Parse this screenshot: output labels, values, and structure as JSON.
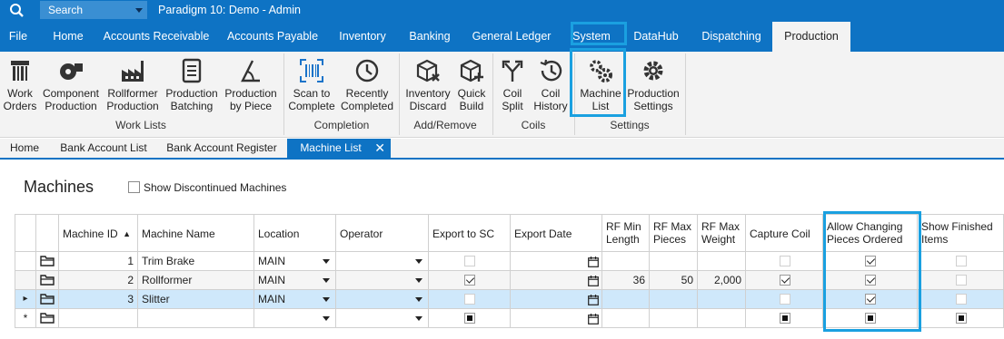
{
  "titlebar": {
    "search_placeholder": "Search",
    "app_title": "Paradigm 10: Demo - Admin"
  },
  "menu": {
    "items": [
      "File",
      "Home",
      "Accounts Receivable",
      "Accounts Payable",
      "Inventory",
      "Banking",
      "General Ledger",
      "System",
      "DataHub",
      "Dispatching",
      "Production"
    ],
    "active": "Production"
  },
  "ribbon": {
    "buttons": [
      {
        "line1": "Work",
        "line2": "Orders",
        "icon": "barcode-ruler-icon"
      },
      {
        "line1": "Component",
        "line2": "Production",
        "icon": "film-reel-icon"
      },
      {
        "line1": "Rollformer",
        "line2": "Production",
        "icon": "factory-icon"
      },
      {
        "line1": "Production",
        "line2": "Batching",
        "icon": "document-list-icon"
      },
      {
        "line1": "Production",
        "line2": "by Piece",
        "icon": "angle-icon"
      },
      {
        "line1": "Scan to",
        "line2": "Complete",
        "icon": "barcode-scan-icon"
      },
      {
        "line1": "Recently",
        "line2": "Completed",
        "icon": "clock-check-icon"
      },
      {
        "line1": "Inventory",
        "line2": "Discard",
        "icon": "box-discard-icon"
      },
      {
        "line1": "Quick",
        "line2": "Build",
        "icon": "box-add-icon"
      },
      {
        "line1": "Coil",
        "line2": "Split",
        "icon": "split-arrows-icon"
      },
      {
        "line1": "Coil",
        "line2": "History",
        "icon": "history-icon"
      },
      {
        "line1": "Machine",
        "line2": "List",
        "icon": "gears-icon"
      },
      {
        "line1": "Production",
        "line2": "Settings",
        "icon": "gear-icon"
      }
    ],
    "groups": [
      "Work Lists",
      "Completion",
      "Add/Remove",
      "Coils",
      "Settings"
    ]
  },
  "tabs": {
    "items": [
      "Home",
      "Bank Account List",
      "Bank Account Register",
      "Machine List"
    ],
    "active": "Machine List",
    "close": "✕"
  },
  "page": {
    "title": "Machines",
    "show_discontinued_label": "Show Discontinued Machines",
    "show_discontinued_checked": false
  },
  "grid": {
    "columns": [
      {
        "key": "machine_id",
        "label": "Machine ID",
        "sort": "ascending"
      },
      {
        "key": "machine_name",
        "label": "Machine Name"
      },
      {
        "key": "location",
        "label": "Location"
      },
      {
        "key": "operator",
        "label": "Operator"
      },
      {
        "key": "export_to_sc",
        "label": "Export to SC"
      },
      {
        "key": "export_date",
        "label": "Export Date"
      },
      {
        "key": "rf_min_length",
        "label": "RF Min Length",
        "l1": "RF Min",
        "l2": "Length"
      },
      {
        "key": "rf_max_pieces",
        "label": "RF Max Pieces",
        "l1": "RF Max",
        "l2": "Pieces"
      },
      {
        "key": "rf_max_weight",
        "label": "RF Max Weight",
        "l1": "RF Max",
        "l2": "Weight"
      },
      {
        "key": "capture_coil",
        "label": "Capture Coil"
      },
      {
        "key": "allow_changing",
        "label": "Allow Changing Pieces Ordered",
        "l1": "Allow Changing",
        "l2": "Pieces Ordered"
      },
      {
        "key": "show_finished",
        "label": "Show Finished Items",
        "l1": "Show Finished",
        "l2": "Items"
      }
    ],
    "rows": [
      {
        "machine_id": "1",
        "machine_name": "Trim Brake",
        "location": "MAIN",
        "operator": "",
        "export_to_sc": false,
        "export_date": "",
        "rf_min_length": "",
        "rf_max_pieces": "",
        "rf_max_weight": "",
        "capture_coil": false,
        "allow_changing": true,
        "show_finished": false
      },
      {
        "machine_id": "2",
        "machine_name": "Rollformer",
        "location": "MAIN",
        "operator": "",
        "export_to_sc": true,
        "export_date": "",
        "rf_min_length": "36",
        "rf_max_pieces": "50",
        "rf_max_weight": "2,000",
        "capture_coil": true,
        "allow_changing": true,
        "show_finished": false
      },
      {
        "machine_id": "3",
        "machine_name": "Slitter",
        "location": "MAIN",
        "operator": "",
        "export_to_sc": false,
        "export_date": "",
        "rf_min_length": "",
        "rf_max_pieces": "",
        "rf_max_weight": "",
        "capture_coil": false,
        "allow_changing": true,
        "show_finished": false,
        "selected": true
      }
    ],
    "new_row_marker": "*",
    "current_row_marker": "▸"
  },
  "colors": {
    "brand_blue": "#0e73c4",
    "highlight": "#1aa0e0",
    "selected_row": "#cfe8fb"
  }
}
